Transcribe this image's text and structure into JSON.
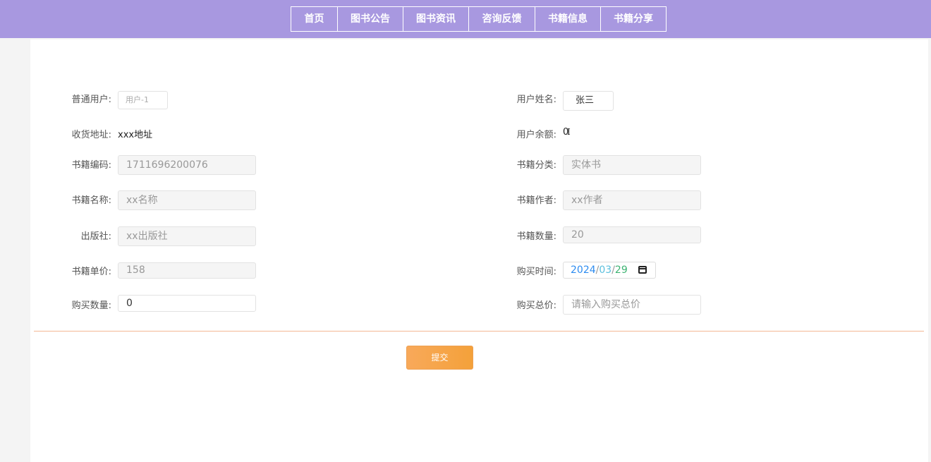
{
  "nav": {
    "items": [
      {
        "label": "首页"
      },
      {
        "label": "图书公告"
      },
      {
        "label": "图书资讯"
      },
      {
        "label": "咨询反馈"
      },
      {
        "label": "书籍信息"
      },
      {
        "label": "书籍分享"
      }
    ]
  },
  "form": {
    "user_type": {
      "label": "普通用户:",
      "value": "用户-1"
    },
    "user_name": {
      "label": "用户姓名:",
      "value": "张三"
    },
    "address": {
      "label": "收货地址:",
      "value": "xxx地址"
    },
    "balance": {
      "label": "用户余额:",
      "value": "0"
    },
    "book_code": {
      "label": "书籍编码:",
      "value": "1711696200076"
    },
    "book_category": {
      "label": "书籍分类:",
      "value": "实体书"
    },
    "book_name": {
      "label": "书籍名称:",
      "value": "xx名称"
    },
    "book_author": {
      "label": "书籍作者:",
      "value": "xx作者"
    },
    "publisher": {
      "label": "出版社:",
      "value": "xx出版社"
    },
    "book_quantity": {
      "label": "书籍数量:",
      "value": "20"
    },
    "unit_price": {
      "label": "书籍单价:",
      "value": "158"
    },
    "purchase_time": {
      "label": "购买时间:",
      "year": "2024",
      "month": "03",
      "day": "29",
      "sep": "/"
    },
    "purchase_quantity": {
      "label": "购买数量:",
      "value": "0"
    },
    "total_price": {
      "label": "购买总价:",
      "placeholder": "请输入购买总价"
    }
  },
  "submit_label": "提交",
  "colors": {
    "topbar": "#a898e0",
    "button": "#f4a13a",
    "divider": "#f4b894",
    "date_year": "#2d8cf0",
    "date_month": "#5bc0de",
    "date_day": "#3cb371"
  },
  "icons": {
    "calendar": "calendar-icon"
  }
}
